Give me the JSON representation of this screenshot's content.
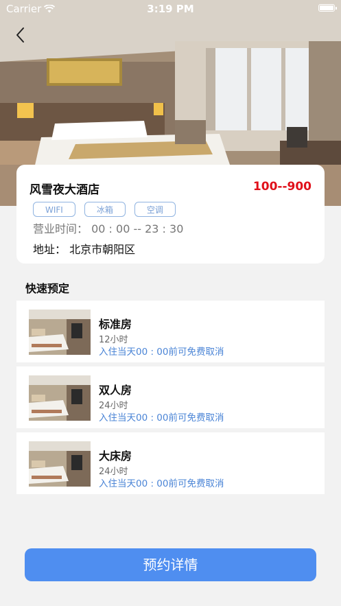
{
  "status_bar": {
    "carrier": "Carrier",
    "time": "3:19 PM"
  },
  "hotel": {
    "name": "风雪夜大酒店",
    "price_range": "100--900",
    "tags": [
      "WIFI",
      "冰箱",
      "空调"
    ],
    "hours": "营业时间：  00 : 00 -- 23 : 30",
    "address": "地址：  北京市朝阳区"
  },
  "quick_booking": {
    "title": "快速预定",
    "rooms": [
      {
        "name": "标准房",
        "duration": "12小时",
        "cancel_note": "入住当天00 : 00前可免费取消"
      },
      {
        "name": "双人房",
        "duration": "24小时",
        "cancel_note": "入住当天00 : 00前可免费取消"
      },
      {
        "name": "大床房",
        "duration": "24小时",
        "cancel_note": "入住当天00 : 00前可免费取消"
      }
    ]
  },
  "book_button_label": "预约详情",
  "colors": {
    "accent": "#4f8ef0",
    "price": "#e0101a",
    "tag": "#7aa0d6",
    "link": "#4a84d6"
  }
}
